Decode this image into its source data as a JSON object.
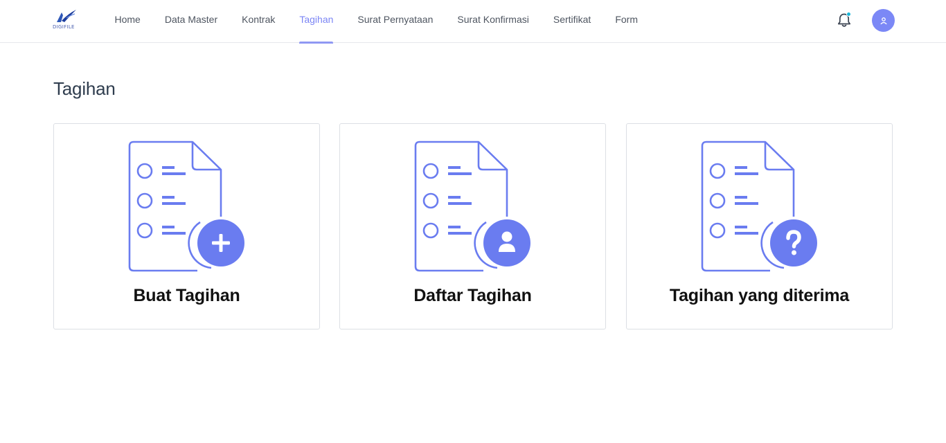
{
  "app": {
    "logo_text": "DIGIFILE",
    "brand_color": "#6b7cf0"
  },
  "nav": {
    "items": [
      {
        "label": "Home"
      },
      {
        "label": "Data Master"
      },
      {
        "label": "Kontrak"
      },
      {
        "label": "Tagihan",
        "active": true
      },
      {
        "label": "Surat Pernyataan"
      },
      {
        "label": "Surat Konfirmasi"
      },
      {
        "label": "Sertifikat"
      },
      {
        "label": "Form"
      }
    ],
    "active_color": "#7b85f5"
  },
  "header": {
    "notification_icon": "bell-icon",
    "notification_dot_color": "#19b6d8",
    "avatar_icon": "user-icon"
  },
  "page": {
    "title": "Tagihan"
  },
  "cards": [
    {
      "label": "Buat Tagihan",
      "icon": "document-plus-icon"
    },
    {
      "label": "Daftar Tagihan",
      "icon": "document-user-icon"
    },
    {
      "label": "Tagihan yang diterima",
      "icon": "document-question-icon"
    }
  ]
}
